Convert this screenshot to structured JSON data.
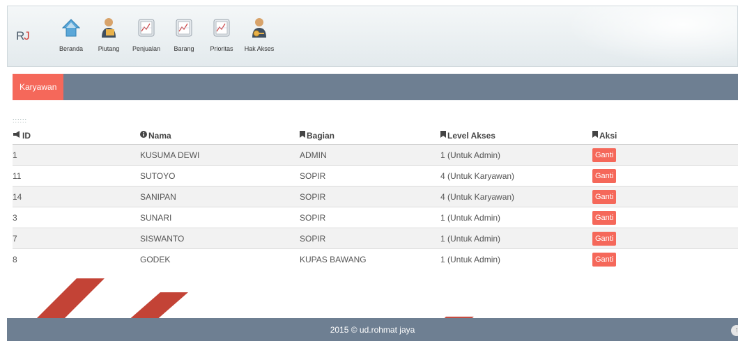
{
  "header": {
    "logo": {
      "r": "R",
      "j": "J"
    },
    "nav": [
      {
        "label": "Beranda",
        "icon": "home-icon"
      },
      {
        "label": "Piutang",
        "icon": "user-icon"
      },
      {
        "label": "Penjualan",
        "icon": "chart-icon"
      },
      {
        "label": "Barang",
        "icon": "chart-icon"
      },
      {
        "label": "Prioritas",
        "icon": "chart-icon"
      },
      {
        "label": "Hak Akses",
        "icon": "user-key-icon"
      }
    ]
  },
  "panel": {
    "tab": "Karyawan"
  },
  "table": {
    "dots": "::::::",
    "headers": {
      "id": "ID",
      "nama": "Nama",
      "bagian": "Bagian",
      "level": "Level Akses",
      "aksi": "Aksi"
    },
    "rows": [
      {
        "id": "1",
        "nama": "KUSUMA DEWI",
        "bagian": "ADMIN",
        "level": "1 (Untuk Admin)",
        "aksi": "Ganti"
      },
      {
        "id": "11",
        "nama": "SUTOYO",
        "bagian": "SOPIR",
        "level": "4 (Untuk Karyawan)",
        "aksi": "Ganti"
      },
      {
        "id": "14",
        "nama": "SANIPAN",
        "bagian": "SOPIR",
        "level": "4 (Untuk Karyawan)",
        "aksi": "Ganti"
      },
      {
        "id": "3",
        "nama": "SUNARI",
        "bagian": "SOPIR",
        "level": "1 (Untuk Admin)",
        "aksi": "Ganti"
      },
      {
        "id": "7",
        "nama": "SISWANTO",
        "bagian": "SOPIR",
        "level": "1 (Untuk Admin)",
        "aksi": "Ganti"
      },
      {
        "id": "8",
        "nama": "GODEK",
        "bagian": "KUPAS BAWANG",
        "level": "1 (Untuk Admin)",
        "aksi": "Ganti"
      }
    ]
  },
  "footer": {
    "text": "2015 © ud.rohmat jaya"
  },
  "colors": {
    "accent": "#f5685a",
    "bar": "#6e7f92"
  }
}
